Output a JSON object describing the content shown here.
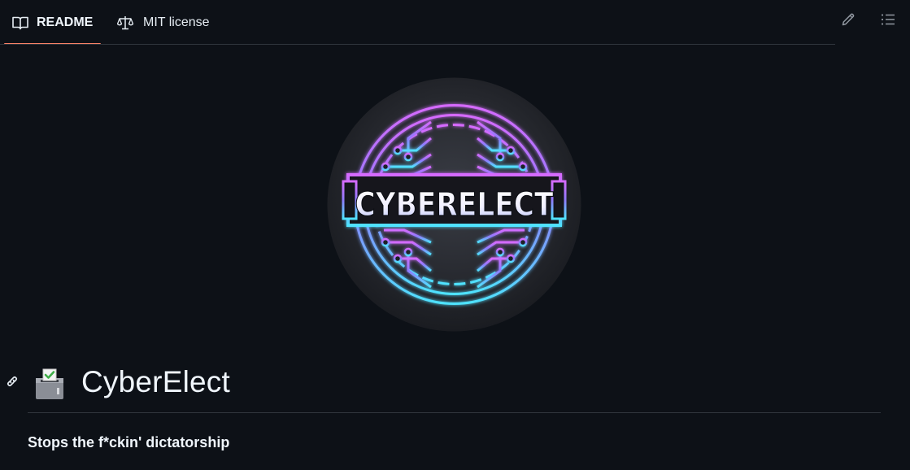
{
  "tabs": {
    "readme": {
      "label": "README",
      "icon": "book-icon",
      "active": true
    },
    "license": {
      "label": "MIT license",
      "icon": "law-scale-icon"
    }
  },
  "actions": {
    "edit_icon": "pencil-icon",
    "toc_icon": "list-icon"
  },
  "logo": {
    "text": "CYBERELECT",
    "colors": {
      "top": "#d66bff",
      "mid": "#8f7bff",
      "bottom": "#4fe3ff"
    }
  },
  "readme": {
    "title": "CyberElect",
    "title_emoji": "ballot-box-icon",
    "tagline": "Stops the f*ckin' dictatorship"
  },
  "colors": {
    "background": "#0d1117",
    "active_tab_underline": "#f78166",
    "border": "#30363d"
  }
}
